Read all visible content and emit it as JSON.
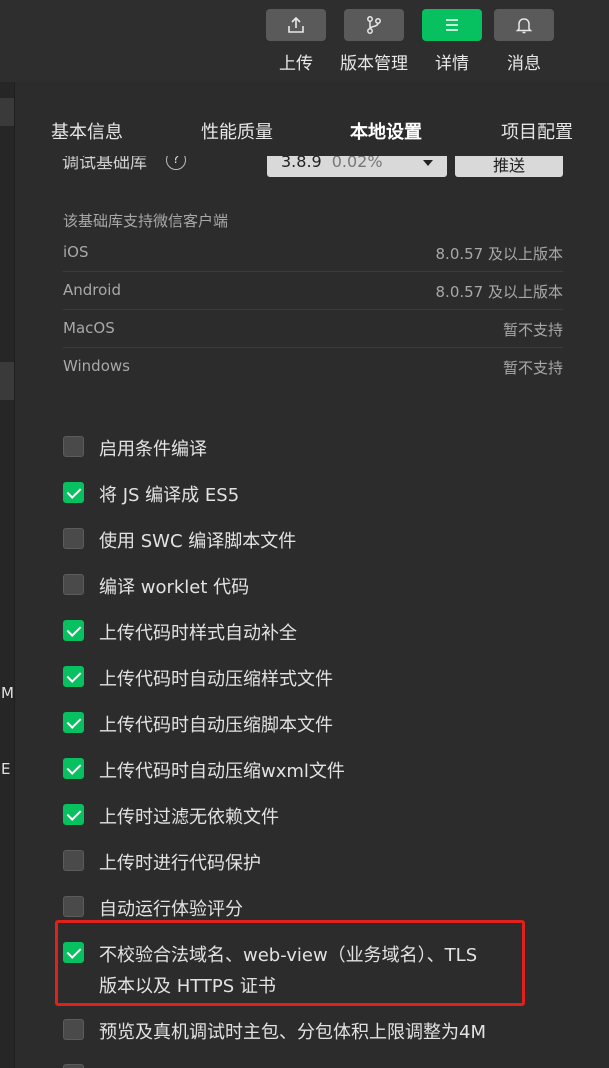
{
  "toolbar": {
    "items": [
      {
        "label": "上传",
        "icon": "upload-icon"
      },
      {
        "label": "版本管理",
        "icon": "branch-icon"
      },
      {
        "label": "详情",
        "icon": "menu-icon",
        "active": true
      },
      {
        "label": "消息",
        "icon": "bell-icon"
      }
    ],
    "accent": "#07c160"
  },
  "left_strip": {
    "text_a": "M",
    "text_b": "E"
  },
  "tabs": [
    "基本信息",
    "性能质量",
    "本地设置",
    "项目配置"
  ],
  "active_tab": "本地设置",
  "debug_lib": {
    "label": "调试基础库",
    "help": "?",
    "version": "3.8.9",
    "share": "0.02%",
    "push_label": "推送"
  },
  "support": {
    "title": "该基础库支持微信客户端",
    "platforms": [
      {
        "name": "iOS",
        "value": "8.0.57 及以上版本"
      },
      {
        "name": "Android",
        "value": "8.0.57 及以上版本"
      },
      {
        "name": "MacOS",
        "value": "暂不支持"
      },
      {
        "name": "Windows",
        "value": "暂不支持"
      }
    ]
  },
  "options": [
    {
      "label": "启用条件编译",
      "checked": false
    },
    {
      "label": "将 JS 编译成 ES5",
      "checked": true
    },
    {
      "label": "使用 SWC 编译脚本文件",
      "checked": false
    },
    {
      "label": "编译 worklet 代码",
      "checked": false
    },
    {
      "label": "上传代码时样式自动补全",
      "checked": true
    },
    {
      "label": "上传代码时自动压缩样式文件",
      "checked": true
    },
    {
      "label": "上传代码时自动压缩脚本文件",
      "checked": true
    },
    {
      "label": "上传代码时自动压缩wxml文件",
      "checked": true
    },
    {
      "label": "上传时过滤无依赖文件",
      "checked": true
    },
    {
      "label": "上传时进行代码保护",
      "checked": false
    },
    {
      "label": "自动运行体验评分",
      "checked": false
    },
    {
      "label": "不校验合法域名、web-view（业务域名）、TLS",
      "label2": "版本以及 HTTPS 证书",
      "checked": true
    },
    {
      "label": "预览及真机调试时主包、分包体积上限调整为4M",
      "checked": false
    }
  ]
}
